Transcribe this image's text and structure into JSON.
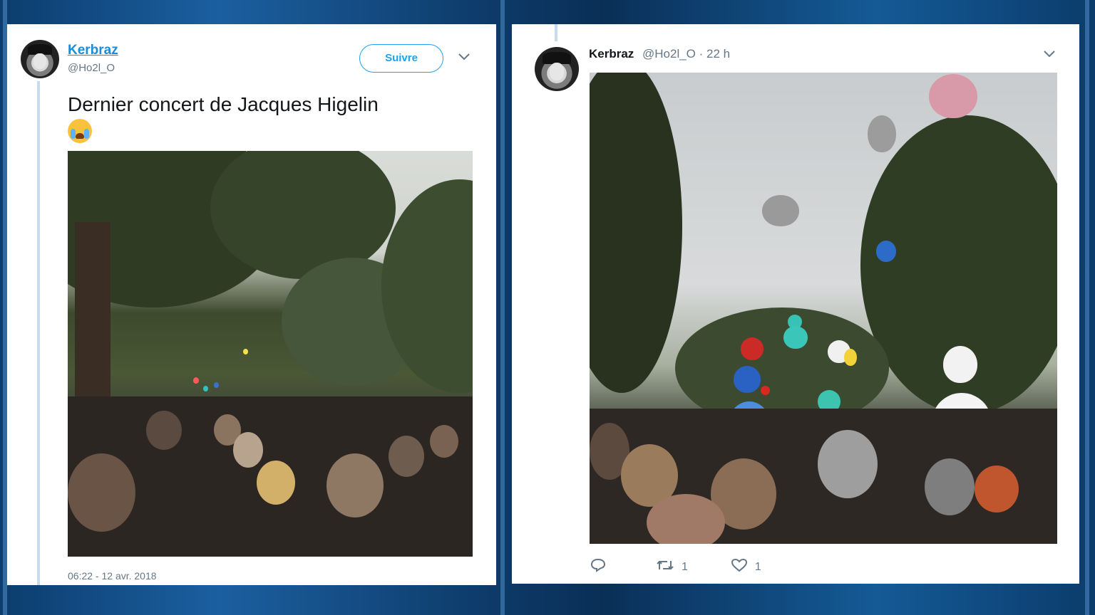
{
  "left_tweet": {
    "display_name": "Kerbraz",
    "handle": "@Ho2l_O",
    "follow_label": "Suivre",
    "text": "Dernier concert de Jacques Higelin",
    "emoji": "loudly-crying-face",
    "timestamp": "06:22 - 12 avr. 2018"
  },
  "right_tweet": {
    "display_name": "Kerbraz",
    "handle_time": "@Ho2l_O · 22 h",
    "retweet_count": "1",
    "like_count": "1"
  },
  "colors": {
    "accent": "#1da1f2",
    "link": "#1a8cd8",
    "muted": "#657786",
    "text": "#14171a"
  },
  "icons": [
    "caret-down-icon",
    "reply-icon",
    "retweet-icon",
    "like-icon"
  ]
}
